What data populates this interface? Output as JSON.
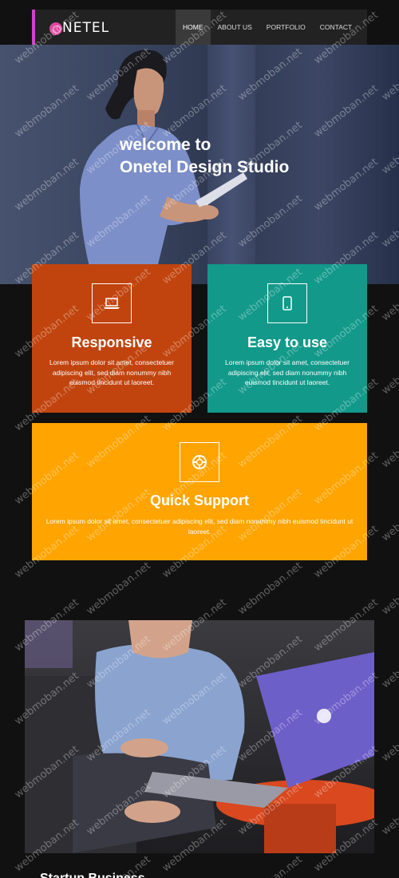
{
  "header": {
    "logo_text": "NETEL",
    "nav": [
      {
        "label": "HOME",
        "active": true
      },
      {
        "label": "ABOUT US",
        "active": false
      },
      {
        "label": "PORTFOLIO",
        "active": false
      },
      {
        "label": "CONTACT",
        "active": false
      }
    ]
  },
  "hero": {
    "line1": "welcome to",
    "line2": "Onetel Design Studio"
  },
  "features": [
    {
      "title": "Responsive",
      "text": "Lorem ipsum dolor sit amet, consectetuer adipiscing elit, sed diam nonummy nibh euismod tincidunt ut laoreet.",
      "icon": "laptop-icon",
      "color": "#c1440e"
    },
    {
      "title": "Easy to use",
      "text": "Lorem ipsum dolor sit amet, consectetuer adipiscing elit, sed diam nonummy nibh euismod tincidunt ut laoreet.",
      "icon": "mobile-icon",
      "color": "#12998a"
    },
    {
      "title": "Quick Support",
      "text": "Lorem ipsum dolor sit amet, consectetuer adipiscing elit, sed diam nonummy nibh euismod tincidunt ut laoreet.",
      "icon": "lifebuoy-icon",
      "color": "#ffa400"
    }
  ],
  "section2": {
    "title": "Startup Business"
  },
  "watermark": "webmoban.net",
  "colors": {
    "background": "#111111",
    "nav_bg": "#222222",
    "accent": "#cc44cc",
    "logo": "#e0479e"
  }
}
